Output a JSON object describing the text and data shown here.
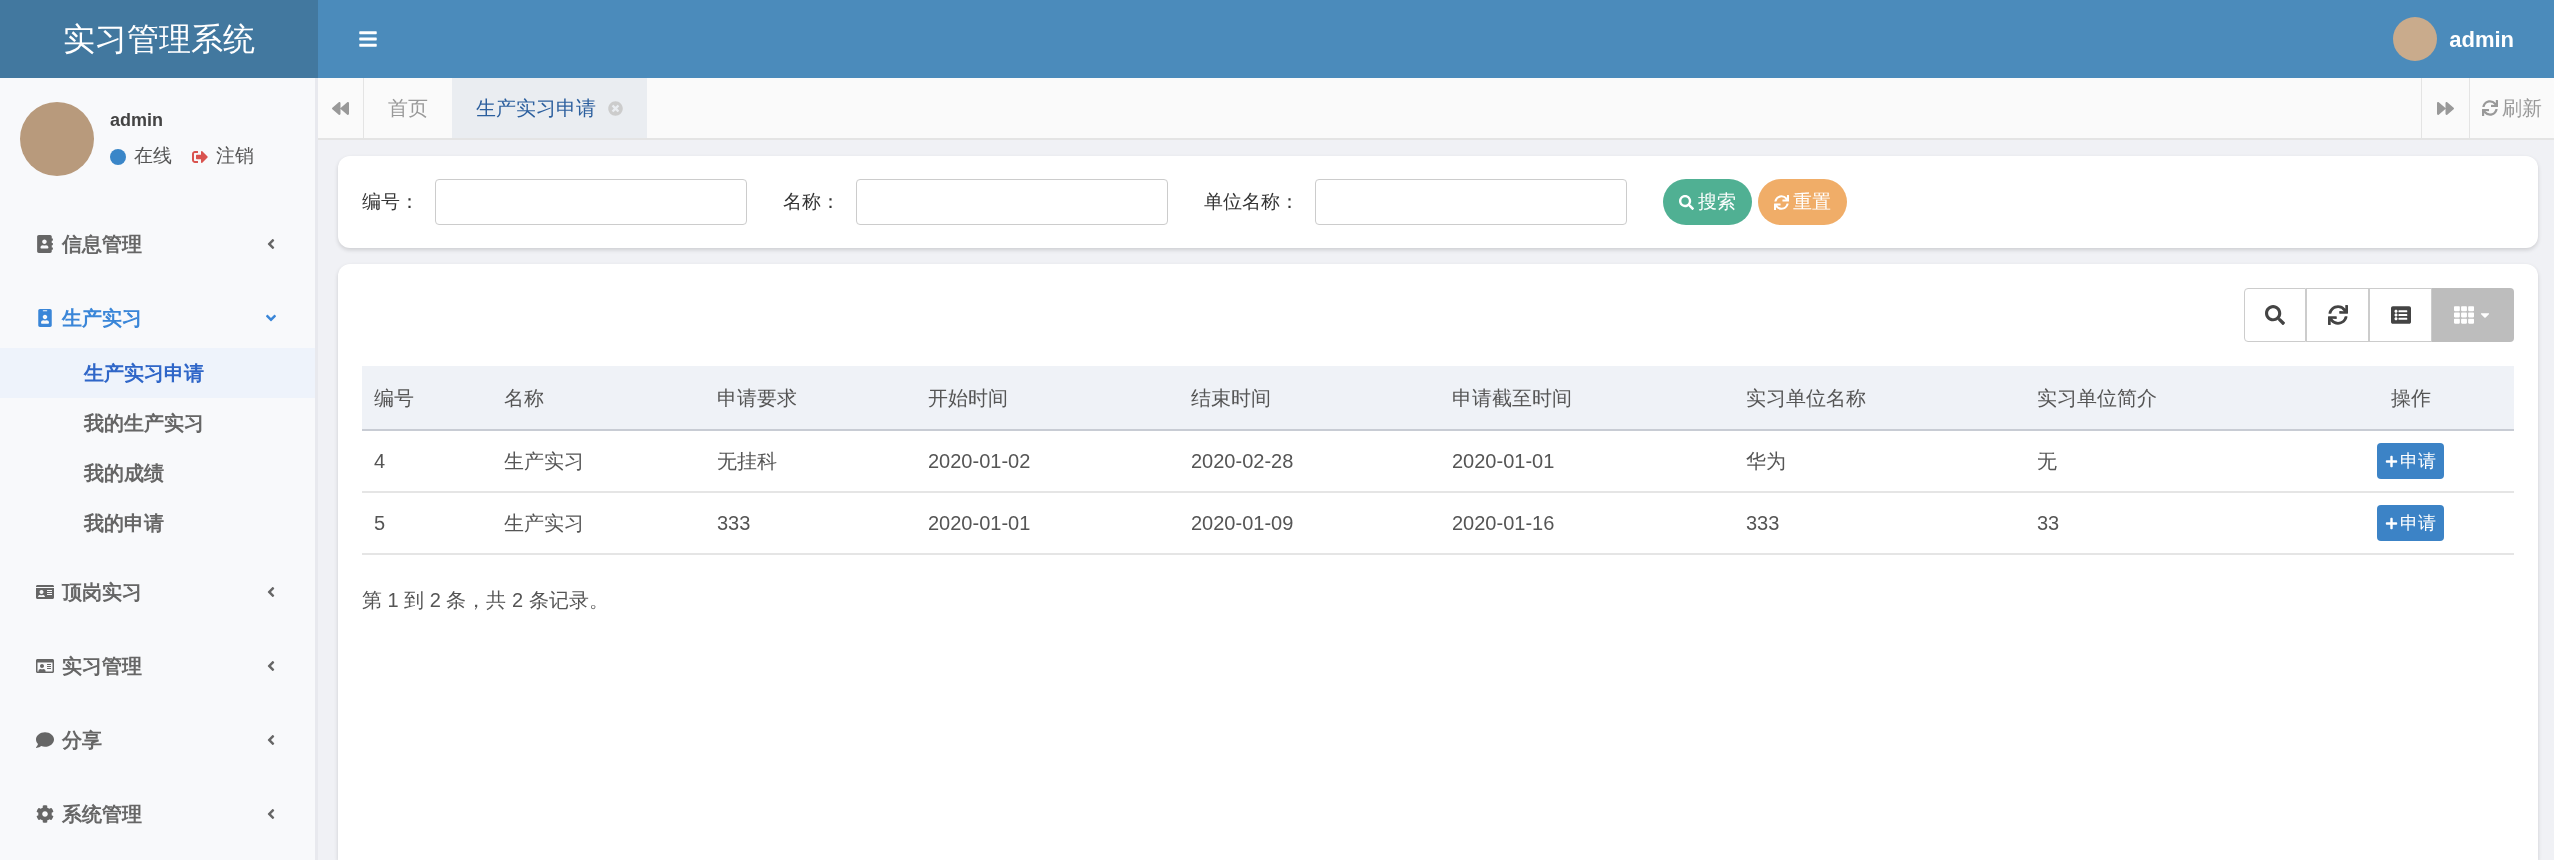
{
  "header": {
    "title": "实习管理系统",
    "user": "admin"
  },
  "sidebar": {
    "user": {
      "name": "admin",
      "status": "在线",
      "logout": "注销"
    },
    "menu": [
      {
        "label": "信息管理",
        "expanded": false
      },
      {
        "label": "生产实习",
        "expanded": true,
        "children": [
          {
            "label": "生产实习申请",
            "selected": true
          },
          {
            "label": "我的生产实习",
            "selected": false
          },
          {
            "label": "我的成绩",
            "selected": false
          },
          {
            "label": "我的申请",
            "selected": false
          }
        ]
      },
      {
        "label": "顶岗实习",
        "expanded": false
      },
      {
        "label": "实习管理",
        "expanded": false
      },
      {
        "label": "分享",
        "expanded": false
      },
      {
        "label": "系统管理",
        "expanded": false
      }
    ]
  },
  "tabs": [
    {
      "label": "首页",
      "selected": false,
      "closable": false
    },
    {
      "label": "生产实习申请",
      "selected": true,
      "closable": true
    }
  ],
  "refresh": "刷新",
  "search_form": {
    "fields": [
      {
        "label": "编号："
      },
      {
        "label": "名称："
      },
      {
        "label": "单位名称："
      }
    ],
    "buttons": [
      {
        "kind": "search",
        "label": "搜索"
      },
      {
        "kind": "reset",
        "label": "重置"
      }
    ]
  },
  "table": {
    "columns": [
      "编号",
      "名称",
      "申请要求",
      "开始时间",
      "结束时间",
      "申请截至时间",
      "实习单位名称",
      "实习单位简介",
      "操作"
    ],
    "rows": [
      {
        "cells": [
          "4",
          "生产实习",
          "无挂科",
          "2020-01-02",
          "2020-02-28",
          "2020-01-01",
          "华为",
          "无"
        ],
        "action": "申请"
      },
      {
        "cells": [
          "5",
          "生产实习",
          "333",
          "2020-01-01",
          "2020-01-09",
          "2020-01-16",
          "333",
          "33"
        ],
        "action": "申请"
      }
    ],
    "summary": "第 1 到 2 条，共 2 条记录。"
  }
}
